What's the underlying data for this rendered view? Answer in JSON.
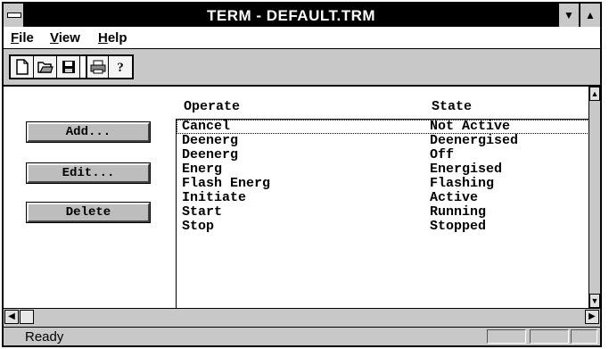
{
  "window": {
    "title": "TERM - DEFAULT.TRM"
  },
  "menu": {
    "items": [
      {
        "label": "File"
      },
      {
        "label": "View"
      },
      {
        "label": "Help"
      }
    ]
  },
  "toolbar": {
    "icons": [
      "new-document-icon",
      "open-folder-icon",
      "save-icon",
      "print-icon",
      "help-icon"
    ]
  },
  "buttons": {
    "add": "Add...",
    "edit": "Edit...",
    "delete": "Delete"
  },
  "list": {
    "columns": {
      "operate": "Operate",
      "state": "State"
    },
    "rows": [
      {
        "operate": "Cancel",
        "state": "Not Active"
      },
      {
        "operate": "Deenerg",
        "state": "Deenergised"
      },
      {
        "operate": "Deenerg",
        "state": "Off"
      },
      {
        "operate": "Energ",
        "state": "Energised"
      },
      {
        "operate": "Flash Energ",
        "state": "Flashing"
      },
      {
        "operate": "Initiate",
        "state": "Active"
      },
      {
        "operate": "Start",
        "state": "Running"
      },
      {
        "operate": "Stop",
        "state": "Stopped"
      }
    ],
    "selected_index": 0
  },
  "status": {
    "text": "Ready"
  }
}
